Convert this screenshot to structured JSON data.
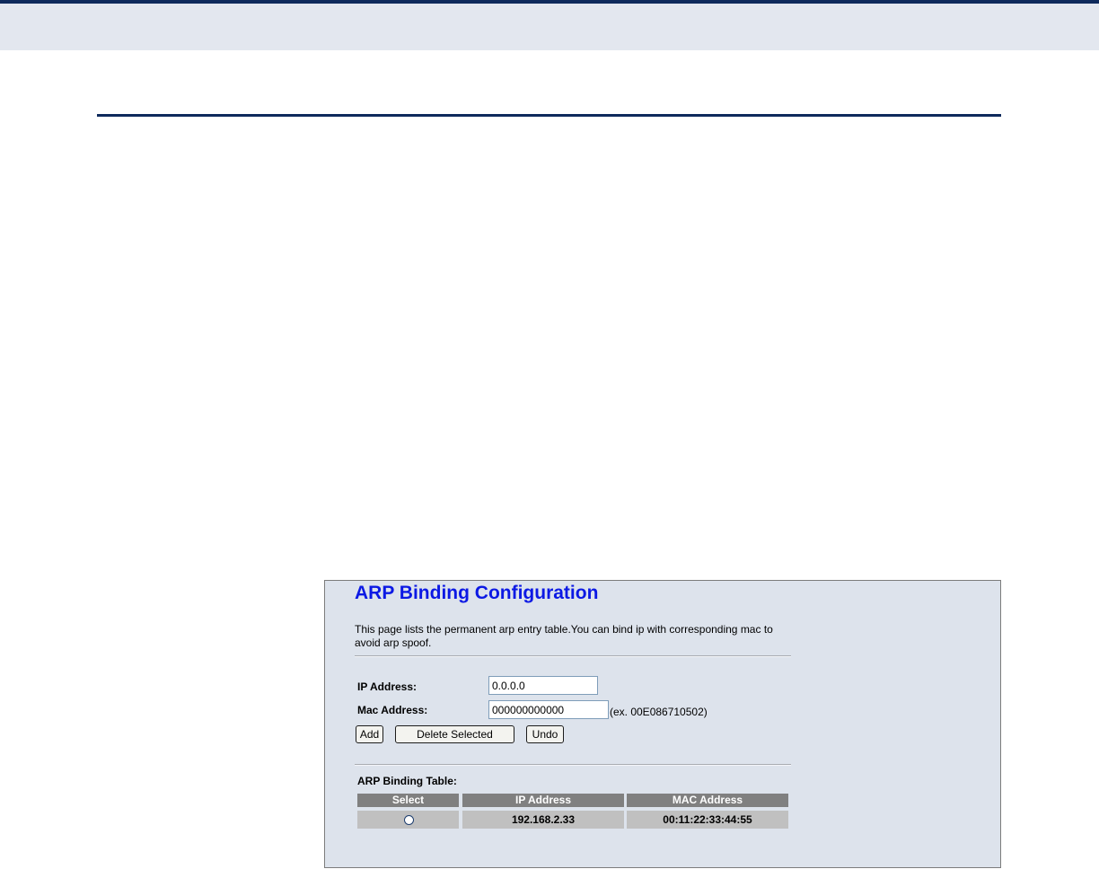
{
  "page": {
    "title": "ARP Binding Configuration",
    "description": "This page lists the permanent arp entry table.You can bind ip with corresponding mac to avoid arp spoof."
  },
  "form": {
    "ip_label": "IP Address:",
    "ip_value": "0.0.0.0",
    "mac_label": "Mac Address:",
    "mac_value": "000000000000",
    "mac_hint": "(ex. 00E086710502)"
  },
  "buttons": {
    "add": "Add",
    "delete_selected": "Delete Selected",
    "undo": "Undo"
  },
  "table": {
    "title": "ARP Binding Table:",
    "columns": [
      "Select",
      "IP Address",
      "MAC Address"
    ],
    "rows": [
      {
        "ip": "192.168.2.33",
        "mac": "00:11:22:33:44:55"
      }
    ]
  },
  "colors": {
    "title": "#0c19e4",
    "panel_bg": "#dde3ec",
    "header_bg": "#808080",
    "row_bg": "#c0c0c0",
    "doc_rule": "#0e2a5c"
  }
}
